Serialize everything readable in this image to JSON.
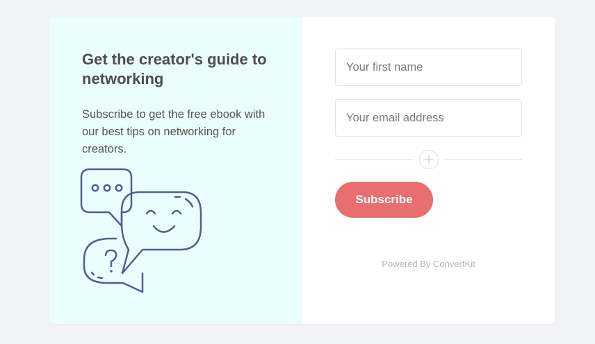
{
  "colors": {
    "page_background": "#f2f3f7",
    "left_panel": "#ebfdff",
    "accent_button": "#e96e70",
    "illustration_stroke": "#4e5e97"
  },
  "left_panel": {
    "headline": "Get the creator's guide to networking",
    "description": "Subscribe to get the free ebook with our best tips on networking for creators.",
    "illustration_icon": "chat-bubbles-icon"
  },
  "form": {
    "first_name_placeholder": "Your first name",
    "first_name_value": "",
    "email_placeholder": "Your email address",
    "email_value": "",
    "add_field_icon": "plus-circle-icon",
    "submit_label": "Subscribe",
    "powered_by": "Powered By ConvertKit"
  }
}
